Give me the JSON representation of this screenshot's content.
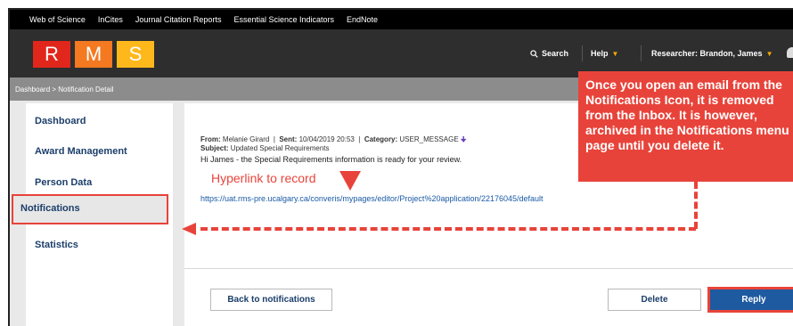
{
  "topnav": [
    "Web of Science",
    "InCites",
    "Journal Citation Reports",
    "Essential Science Indicators",
    "EndNote"
  ],
  "logo": {
    "letters": [
      "R",
      "M",
      "S"
    ]
  },
  "header": {
    "search_label": "Search",
    "help_label": "Help",
    "researcher_label": "Researcher: Brandon, James"
  },
  "breadcrumb": "Dashboard > Notification Detail",
  "sidebar": {
    "items": [
      "Dashboard",
      "Award Management",
      "Person Data",
      "Notifications",
      "Statistics"
    ],
    "selected": "Notifications"
  },
  "message": {
    "from_label": "From:",
    "from_value": "Melanie Girard",
    "sent_label": "Sent:",
    "sent_value": "10/04/2019 20:53",
    "category_label": "Category:",
    "category_value": "USER_MESSAGE",
    "subject_label": "Subject:",
    "subject_value": "Updated Special Requirements",
    "body": "Hi James - the Special Requirements information is ready for your review.",
    "link": "https://uat.rms-pre.ucalgary.ca/converis/mypages/editor/Project%20application/22176045/default"
  },
  "buttons": {
    "back": "Back to notifications",
    "delete": "Delete",
    "reply": "Reply"
  },
  "annotations": {
    "callout": "Once you open an email from the Notifications Icon, it is removed from the Inbox. It is however, archived in the Notifications menu page until you delete it.",
    "hyperlink_label": "Hyperlink to record"
  },
  "colors": {
    "annotation_red": "#e8433a",
    "link_blue": "#1a5aa6",
    "nav_blue": "#1b3e6a",
    "reply_blue": "#1e5aa0"
  }
}
